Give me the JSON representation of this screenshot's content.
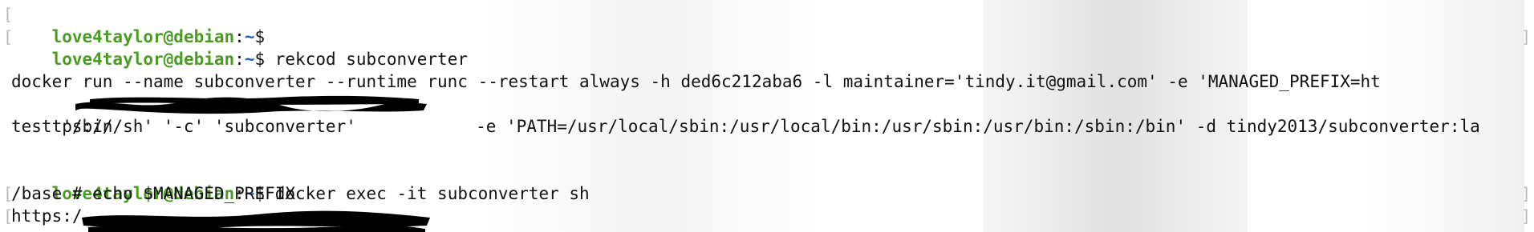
{
  "terminal": {
    "prompt": {
      "user_host": "love4taylor@debian",
      "colon": ":",
      "path": "~",
      "symbol": "$ "
    },
    "lines": [
      {
        "type": "prompt",
        "command": ""
      },
      {
        "type": "prompt",
        "command": "rekcod subconverter"
      },
      {
        "type": "blank",
        "text": ""
      },
      {
        "type": "output",
        "text": "docker run --name subconverter --runtime runc --restart always -h ded6c212aba6 -l maintainer='tindy.it@gmail.com' -e 'MANAGED_PREFIX=ht"
      },
      {
        "type": "output",
        "text": "tps://"
      },
      {
        "type": "output",
        "text": " -e 'PATH=/usr/local/sbin:/usr/local/bin:/usr/sbin:/usr/bin:/sbin:/bin' -d tindy2013/subconverter:la"
      },
      {
        "type": "output",
        "text": "test '/bin/sh' '-c' 'subconverter'"
      },
      {
        "type": "blank",
        "text": ""
      },
      {
        "type": "prompt",
        "command": "docker exec -it subconverter sh"
      },
      {
        "type": "output",
        "text": "/base # echo $MANAGED_PREFIX"
      },
      {
        "type": "output",
        "text": "https:/"
      }
    ],
    "colors": {
      "user_host": "#4a9b22",
      "path": "#1c5fc4",
      "text": "#111111",
      "background": "#ffffff"
    }
  }
}
